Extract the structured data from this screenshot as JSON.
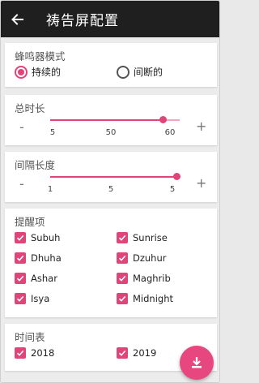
{
  "appbar": {
    "title": "祷告屏配置",
    "back_icon": "arrow-left-icon"
  },
  "colors": {
    "accent": "#e04478",
    "track": "#f0a7be",
    "appbar": "#1f1f1f"
  },
  "buzzer": {
    "title": "蜂鸣器模式",
    "options": [
      {
        "label": "持续的",
        "selected": true
      },
      {
        "label": "间断的",
        "selected": false
      }
    ]
  },
  "duration": {
    "title": "总时长",
    "minus": "-",
    "plus": "+",
    "ticks": [
      "5",
      "50",
      "60"
    ],
    "value_fraction": 0.87
  },
  "interval": {
    "title": "间隔长度",
    "minus": "-",
    "plus": "+",
    "ticks": [
      "1",
      "5",
      "5"
    ],
    "value_fraction": 1.0
  },
  "reminders": {
    "title": "提醒项",
    "items": [
      {
        "label": "Subuh",
        "checked": true
      },
      {
        "label": "Sunrise",
        "checked": true
      },
      {
        "label": "Dhuha",
        "checked": true
      },
      {
        "label": "Dzuhur",
        "checked": true
      },
      {
        "label": "Ashar",
        "checked": true
      },
      {
        "label": "Maghrib",
        "checked": true
      },
      {
        "label": "Isya",
        "checked": true
      },
      {
        "label": "Midnight",
        "checked": true
      }
    ]
  },
  "schedule": {
    "title": "时间表",
    "items": [
      {
        "label": "2018",
        "checked": true
      },
      {
        "label": "2019",
        "checked": true
      }
    ]
  },
  "fab": {
    "icon": "download-icon"
  }
}
